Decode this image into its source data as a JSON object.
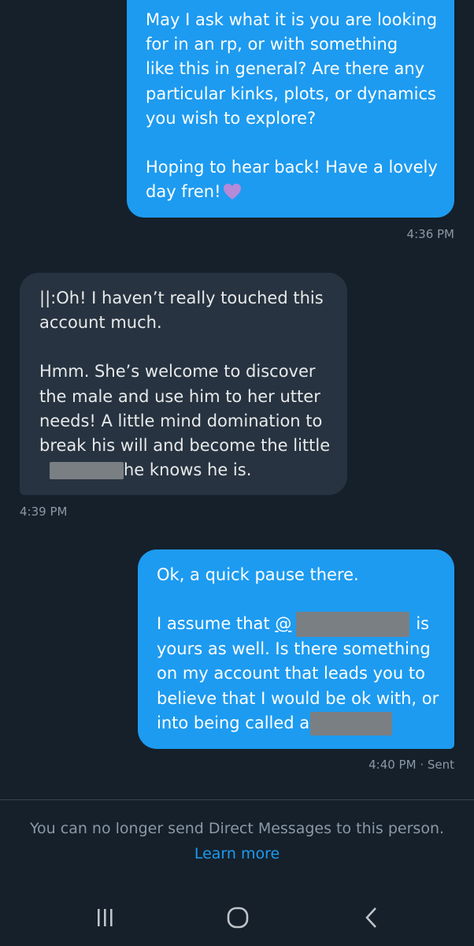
{
  "messages": [
    {
      "direction": "sent",
      "lines": [
        "May I ask what it is you are looking",
        "for in an rp, or with something",
        "like this in general? Are there any",
        "particular kinks, plots, or dynamics",
        "you wish to explore?",
        "",
        "Hoping to hear back! Have a lovely",
        "day fren!"
      ],
      "emoji": "purple-heart",
      "time": "4:36 PM"
    },
    {
      "direction": "received",
      "lines": [
        "||:Oh! I haven’t really touched this",
        "account much.",
        "",
        "Hmm. She’s welcome to discover",
        "the male and use him to her utter",
        "needs! A little mind domination to",
        "break his will and become the little",
        "he knows he is."
      ],
      "time": "4:39 PM"
    },
    {
      "direction": "sent",
      "lines": [
        "Ok, a quick pause there.",
        "",
        "I assume that",
        "@",
        "is",
        "yours as well. Is there something",
        "on my account that leads you to",
        "believe that I would be ok with, or",
        "into being called a"
      ],
      "time": "4:40 PM · Sent"
    }
  ],
  "footer": {
    "notice": "You can no longer send Direct Messages to this person.",
    "link": "Learn more"
  },
  "navbar": {
    "icons": [
      "recent-apps-icon",
      "home-icon",
      "back-icon"
    ]
  },
  "colors": {
    "background": "#15202b",
    "sent_bubble": "#1d9bf0",
    "received_bubble": "#273340",
    "link": "#1d9bf0",
    "muted_text": "#8b98a5"
  }
}
